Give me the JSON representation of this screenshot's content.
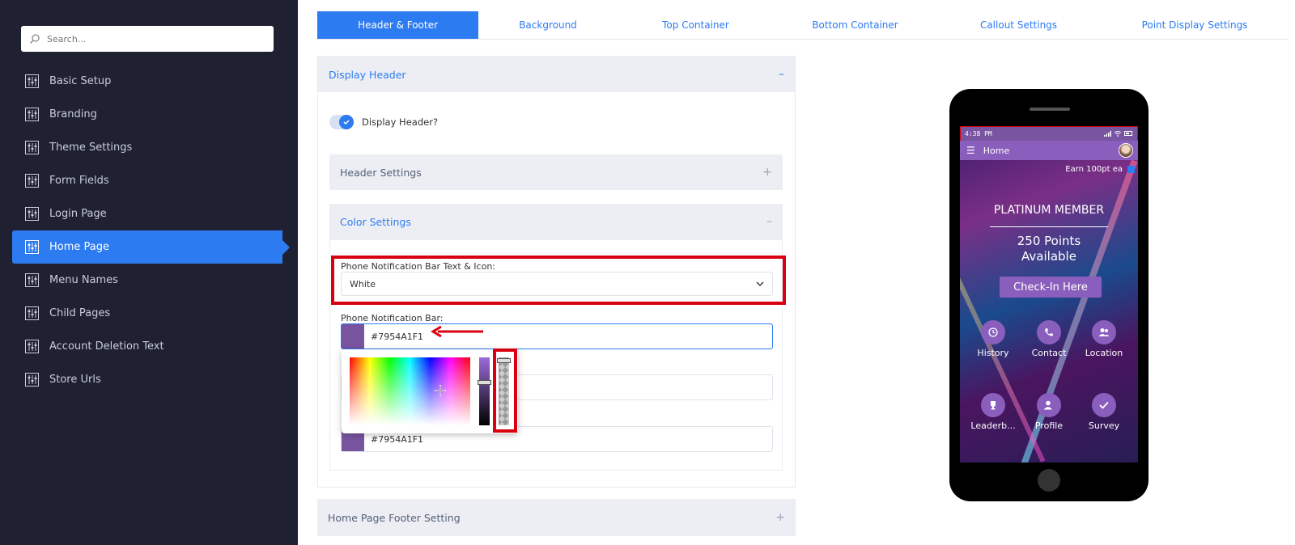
{
  "sidebar": {
    "search_placeholder": "Search...",
    "items": [
      {
        "label": "Basic Setup"
      },
      {
        "label": "Branding"
      },
      {
        "label": "Theme Settings"
      },
      {
        "label": "Form Fields"
      },
      {
        "label": "Login Page"
      },
      {
        "label": "Home Page",
        "active": true
      },
      {
        "label": "Menu Names"
      },
      {
        "label": "Child Pages"
      },
      {
        "label": "Account Deletion Text"
      },
      {
        "label": "Store Urls"
      }
    ]
  },
  "tabs": [
    {
      "label": "Header & Footer",
      "active": true
    },
    {
      "label": "Background"
    },
    {
      "label": "Top Container"
    },
    {
      "label": "Bottom Container"
    },
    {
      "label": "Callout Settings"
    },
    {
      "label": "Point Display Settings"
    }
  ],
  "panel": {
    "title": "Display Header",
    "toggle_label": "Display Header?",
    "toggle_on": true,
    "header_settings": "Header Settings",
    "color_settings": "Color Settings",
    "notif_text_label": "Phone Notification Bar Text & Icon:",
    "notif_text_value": "White",
    "notif_bar_label": "Phone Notification Bar:",
    "notif_bar_value": "#7954A1F1",
    "third_value": "#7954A1F1",
    "footer_title": "Home Page Footer Setting"
  },
  "colors": {
    "accent": "#2d7bf0",
    "sidebar_bg": "#1f2132",
    "purple": "#7954a1",
    "highlight_red": "#d9000f"
  },
  "phone": {
    "time": "4:38 PM",
    "appbar_title": "Home",
    "earn": "Earn 100pt ea",
    "member_title": "PLATINUM MEMBER",
    "points_line1": "250 Points",
    "points_line2": "Available",
    "checkin": "Check-In Here",
    "buttons": [
      {
        "label": "History",
        "icon": "history-icon"
      },
      {
        "label": "Contact",
        "icon": "phone-icon"
      },
      {
        "label": "Location",
        "icon": "users-icon"
      },
      {
        "label": "Leaderb...",
        "icon": "trophy-icon"
      },
      {
        "label": "Profile",
        "icon": "profile-icon"
      },
      {
        "label": "Survey",
        "icon": "check-icon"
      }
    ]
  }
}
